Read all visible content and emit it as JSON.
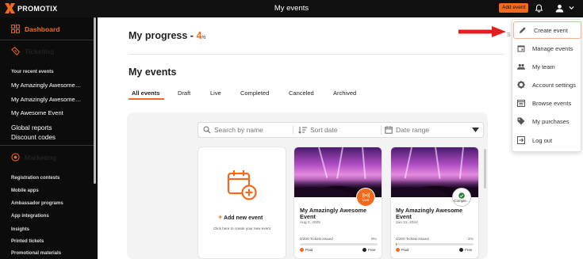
{
  "app": {
    "logo_text": "PROMOTIX",
    "page_title": "My events",
    "add_event_label": "Add event"
  },
  "colors": {
    "accent": "#f26b1d",
    "topbar": "#111111",
    "sidebar": "#0c0c0c"
  },
  "sidebar": {
    "dashboard": "Dashboard",
    "ticketing": "Ticketing",
    "recent_heading": "Your recent events",
    "recent_events": [
      "My Amazingly Awesome…",
      "My Amazingly Awesome…",
      "My Awesome Event"
    ],
    "global_reports": "Global reports",
    "discount_codes": "Discount codes",
    "marketing": "Marketing",
    "marketing_items": [
      "Registration contests",
      "Mobile apps",
      "Ambassador programs",
      "App integrations",
      "Insights",
      "Printed tickets",
      "Promotional materials"
    ]
  },
  "progress": {
    "label": "My progress -",
    "value": "4",
    "total": "/6"
  },
  "events": {
    "heading": "My events",
    "tabs": [
      "All events",
      "Draft",
      "Live",
      "Completed",
      "Canceled",
      "Archived"
    ],
    "active_tab": "All events",
    "filters": {
      "search_placeholder": "Search by name",
      "sort_label": "Sort date",
      "date_label": "Date range"
    },
    "new_card": {
      "label": "Add new event",
      "sub": "Click here to create your new event"
    },
    "cards": [
      {
        "title": "My Amazingly Awesome Event",
        "date": "Aug 2, 2025",
        "issued": "0/200 Tickets issued",
        "percent": "0%",
        "progress": 0,
        "status": "Live",
        "paid": "Paid",
        "free": "Free"
      },
      {
        "title": "My Amazingly Awesome Event",
        "date": "Jan 31, 2024",
        "issued": "2/200 Tickets issued",
        "percent": "1%",
        "progress": 1,
        "status": "Comple...",
        "paid": "Paid",
        "free": "Free"
      }
    ]
  },
  "menu": {
    "items": [
      {
        "label": "Create event",
        "icon": "pencil-icon"
      },
      {
        "label": "Manage events",
        "icon": "calendar-icon"
      },
      {
        "label": "My team",
        "icon": "people-icon"
      },
      {
        "label": "Account settings",
        "icon": "gear-icon"
      },
      {
        "label": "Browse events",
        "icon": "calendar-list-icon"
      },
      {
        "label": "My purchases",
        "icon": "tag-icon"
      },
      {
        "label": "Log out",
        "icon": "logout-icon"
      }
    ]
  },
  "peek_text": "S"
}
